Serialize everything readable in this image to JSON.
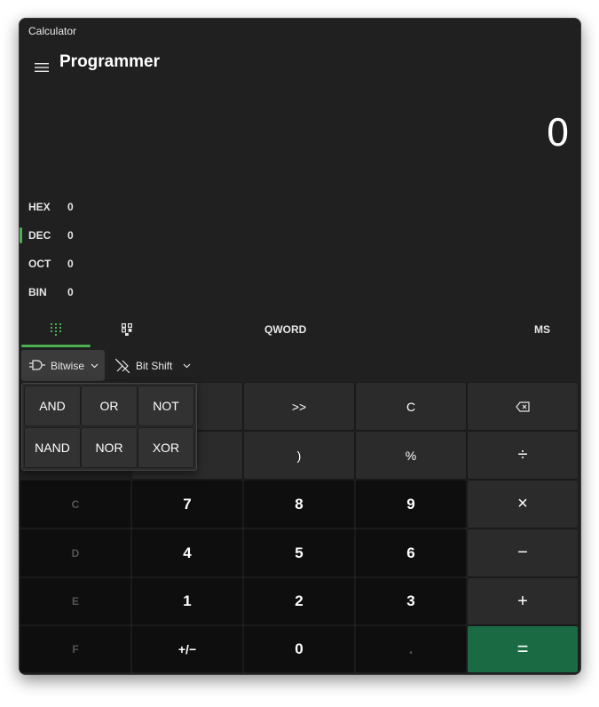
{
  "window": {
    "title": "Calculator",
    "mode": "Programmer"
  },
  "display": {
    "result": "0"
  },
  "radix": [
    {
      "label": "HEX",
      "value": "0"
    },
    {
      "label": "DEC",
      "value": "0",
      "selected": true
    },
    {
      "label": "OCT",
      "value": "0"
    },
    {
      "label": "BIN",
      "value": "0"
    }
  ],
  "tabs": {
    "keypad_icon": "keypad-icon",
    "bit_toggle_icon": "bit-toggling-keypad-icon",
    "word_size": "QWORD",
    "memory_store": "MS"
  },
  "toolbar": {
    "bitwise_label": "Bitwise",
    "bitwise_icon": "logic-gate-icon",
    "bitshift_label": "Bit Shift",
    "bitshift_icon": "bit-shift-icon"
  },
  "flyout": {
    "and": "AND",
    "or": "OR",
    "not": "NOT",
    "nand": "NAND",
    "nor": "NOR",
    "xor": "XOR"
  },
  "keys": {
    "rshift": ">>",
    "clear": "C",
    "backspace_icon": "backspace-icon",
    "close_paren": ")",
    "percent": "%",
    "divide": "÷",
    "hex_c": "C",
    "seven": "7",
    "eight": "8",
    "nine": "9",
    "multiply": "×",
    "hex_d": "D",
    "four": "4",
    "five": "5",
    "six": "6",
    "minus": "−",
    "hex_e": "E",
    "one": "1",
    "two": "2",
    "three": "3",
    "plus": "+",
    "hex_f": "F",
    "negate": "+/−",
    "zero": "0",
    "decimal": ".",
    "equals": "="
  },
  "colors": {
    "accent": "#4caf50",
    "equals_bg": "#1a6b43",
    "window_bg": "#202020"
  }
}
